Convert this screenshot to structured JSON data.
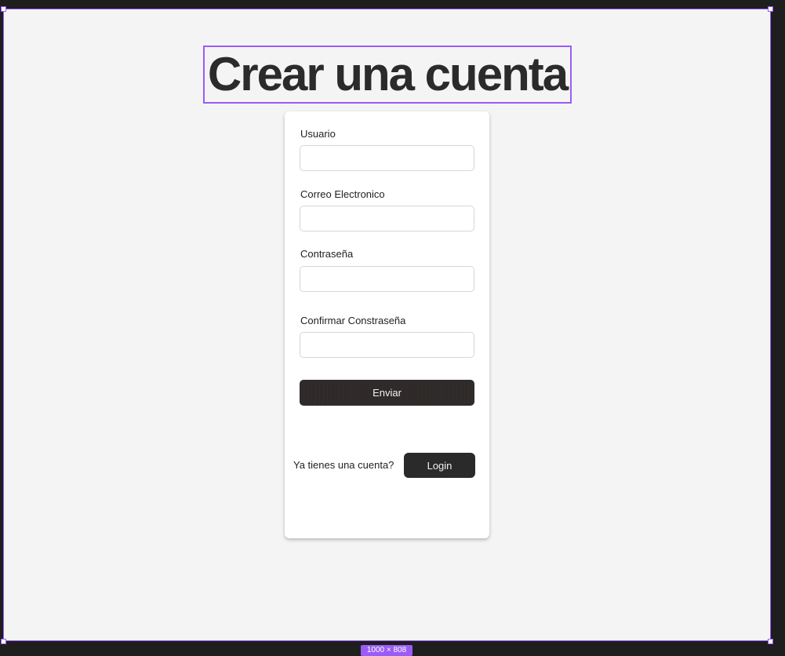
{
  "page": {
    "title": "Crear una cuenta",
    "size_badge": "1000 × 808"
  },
  "form": {
    "fields": [
      {
        "label": "Usuario",
        "value": "",
        "placeholder": ""
      },
      {
        "label": "Correo Electronico",
        "value": "",
        "placeholder": ""
      },
      {
        "label": "Contraseña",
        "value": "",
        "placeholder": ""
      },
      {
        "label": "Confirmar Constraseña",
        "value": "",
        "placeholder": ""
      }
    ],
    "submit_label": "Enviar"
  },
  "footer": {
    "prompt_text": "Ya tienes una cuenta?",
    "login_label": "Login"
  },
  "colors": {
    "selection_accent": "#9b5cf6",
    "button_dark": "#2a2a2a",
    "frame_background": "#f4f4f4",
    "canvas_background": "#1e1e1e"
  }
}
